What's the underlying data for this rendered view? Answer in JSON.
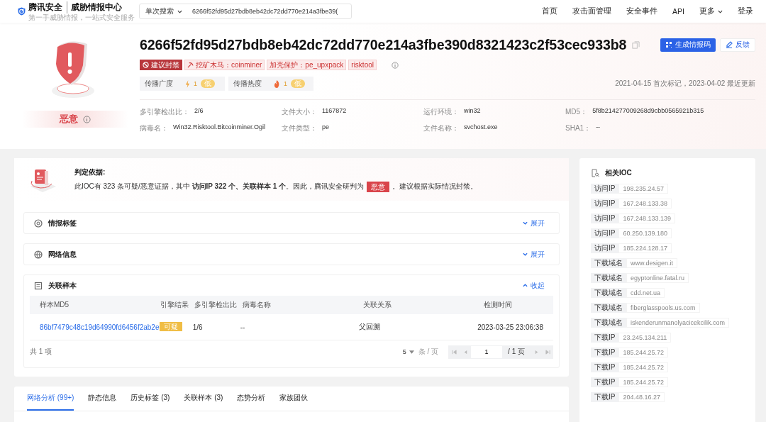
{
  "header": {
    "brand": "腾讯安全",
    "product": "威胁情报中心",
    "slogan": "第一手威胁情报，一站式安全服务"
  },
  "search": {
    "mode": "单次搜索",
    "value": "6266f52fd95d27bdb8eb42dc72dd770e214a3fbe39("
  },
  "nav": [
    {
      "label": "首页",
      "kind": "link"
    },
    {
      "label": "攻击面管理",
      "kind": "link"
    },
    {
      "label": "安全事件",
      "kind": "link"
    },
    {
      "label": "API",
      "kind": "link"
    },
    {
      "label": "更多",
      "kind": "dropdown"
    },
    {
      "label": "登录",
      "kind": "link"
    }
  ],
  "ioc": {
    "hash": "6266f52fd95d27bdb8eb42dc72dd770e214a3fbe390d8321423c2f53cec933b8",
    "verdict": "恶意",
    "buttons": [
      {
        "label": "生成情报码",
        "kind": "primary"
      },
      {
        "label": "反馈",
        "kind": "secondary"
      }
    ],
    "tags": [
      {
        "label": "建议封禁",
        "kind": "block"
      },
      {
        "label": "挖矿木马：coinminer",
        "kind": "icon"
      },
      {
        "label": "加壳保护：pe_upxpack",
        "kind": "plain"
      },
      {
        "label": "risktool",
        "kind": "plain"
      }
    ],
    "metrics": [
      {
        "label": "传播广度",
        "kind": "bolt",
        "value": "1",
        "badge": "低"
      },
      {
        "label": "传播热度",
        "kind": "fire",
        "value": "1",
        "badge": "低"
      }
    ],
    "dates": "2021-04-15 首次标记，2023-04-02 最近更新",
    "info": [
      {
        "label": "多引擎检出比：",
        "value": "2/6"
      },
      {
        "label": "文件大小：",
        "value": "1167872"
      },
      {
        "label": "运行环境：",
        "value": "win32"
      },
      {
        "label": "MD5：",
        "value": "5f8b214277009268d9cbb0565921b315"
      },
      {
        "label": "病毒名：",
        "value": "Win32.Risktool.Bitcoinminer.Ogil"
      },
      {
        "label": "文件类型：",
        "value": "pe"
      },
      {
        "label": "文件名称：",
        "value": "svchost.exe"
      },
      {
        "label": "SHA1：",
        "value": "--"
      }
    ]
  },
  "basis": {
    "title": "判定依据:",
    "text": "此IOC有 323 条可疑/恶意证据，其中 **访问IP 322 个、关联样本 1 个**。因此，腾讯安全研判为",
    "badge": "恶意",
    "tail": "。建议根据实际情况封禁。"
  },
  "sections": [
    {
      "title": "情报标签",
      "expanded": false,
      "toggle": "展开"
    },
    {
      "title": "网络信息",
      "expanded": false,
      "toggle": "展开"
    },
    {
      "title": "关联样本",
      "expanded": true,
      "toggle": "收起"
    }
  ],
  "samples": {
    "columns": [
      "样本MD5",
      "引擎结果",
      "多引擎检出比",
      "病毒名称",
      "关联关系",
      "检测时间"
    ],
    "rows": [
      {
        "md5": "86bf7479c48c19d64990fd6456f2ab2e",
        "result": "可疑",
        "ratio": "1/6",
        "virus": "--",
        "relation": "父回溯",
        "time": "2023-03-25 23:06:38"
      }
    ],
    "total": "共 1 项",
    "page_size": "5",
    "page_size_unit": "条 / 页",
    "page": "1",
    "pages": "/ 1 页"
  },
  "tabs": [
    {
      "label": "网络分析 (99+)",
      "selected": true
    },
    {
      "label": "静态信息",
      "selected": false
    },
    {
      "label": "历史标签 (3)",
      "selected": false
    },
    {
      "label": "关联样本 (3)",
      "selected": false
    },
    {
      "label": "态势分析",
      "selected": false
    },
    {
      "label": "家族团伙",
      "selected": false
    }
  ],
  "related_ioc": {
    "title": "相关IOC",
    "items": [
      {
        "type": "访问IP",
        "value": "198.235.24.57"
      },
      {
        "type": "访问IP",
        "value": "167.248.133.38"
      },
      {
        "type": "访问IP",
        "value": "167.248.133.139"
      },
      {
        "type": "访问IP",
        "value": "60.250.139.180"
      },
      {
        "type": "访问IP",
        "value": "185.224.128.17"
      },
      {
        "type": "下载域名",
        "value": "www.desigen.it"
      },
      {
        "type": "下载域名",
        "value": "egyptonline.fatal.ru"
      },
      {
        "type": "下载域名",
        "value": "cdd.net.ua"
      },
      {
        "type": "下载域名",
        "value": "fiberglasspools.us.com"
      },
      {
        "type": "下载域名",
        "value": "iskenderunmanolyacicekcilik.com"
      },
      {
        "type": "下载IP",
        "value": "23.245.134.211"
      },
      {
        "type": "下载IP",
        "value": "185.244.25.72"
      },
      {
        "type": "下载IP",
        "value": "185.244.25.72"
      },
      {
        "type": "下载IP",
        "value": "185.244.25.72"
      },
      {
        "type": "下载IP",
        "value": "204.48.16.27"
      }
    ]
  }
}
